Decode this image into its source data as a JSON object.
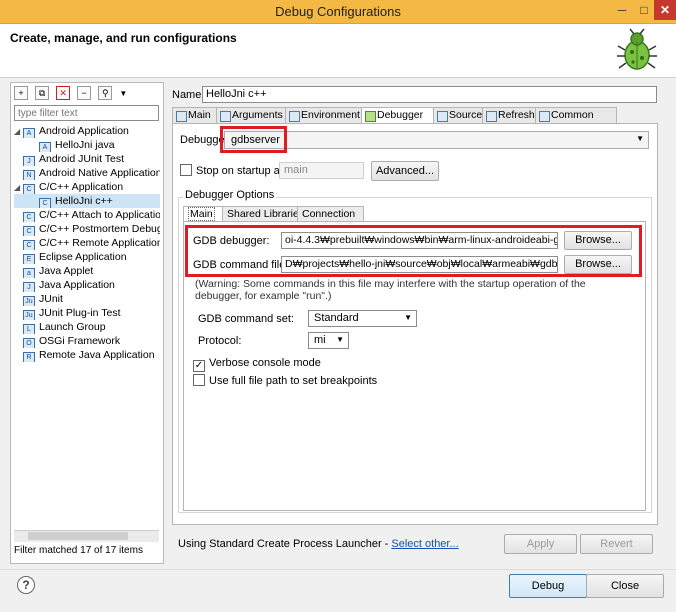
{
  "window": {
    "title": "Debug Configurations",
    "minimize": "─",
    "maximize": "□",
    "close": "✕"
  },
  "banner": {
    "heading": "Create, manage, and run configurations"
  },
  "left": {
    "filter_placeholder": "type filter text",
    "tree": [
      {
        "label": "Android Application",
        "level": 0,
        "toggle": "◢",
        "icon": "A"
      },
      {
        "label": "HelloJni java",
        "level": 1,
        "toggle": "",
        "icon": "A"
      },
      {
        "label": "Android JUnit Test",
        "level": 0,
        "toggle": "",
        "icon": "J"
      },
      {
        "label": "Android Native Application",
        "level": 0,
        "toggle": "",
        "icon": "N"
      },
      {
        "label": "C/C++ Application",
        "level": 0,
        "toggle": "◢",
        "icon": "C"
      },
      {
        "label": "HelloJni c++",
        "level": 1,
        "toggle": "",
        "icon": "C",
        "selected": true
      },
      {
        "label": "C/C++ Attach to Application",
        "level": 0,
        "toggle": "",
        "icon": "C"
      },
      {
        "label": "C/C++ Postmortem Debugger",
        "level": 0,
        "toggle": "",
        "icon": "C"
      },
      {
        "label": "C/C++ Remote Application",
        "level": 0,
        "toggle": "",
        "icon": "C"
      },
      {
        "label": "Eclipse Application",
        "level": 0,
        "toggle": "",
        "icon": "E"
      },
      {
        "label": "Java Applet",
        "level": 0,
        "toggle": "",
        "icon": "a"
      },
      {
        "label": "Java Application",
        "level": 0,
        "toggle": "",
        "icon": "J"
      },
      {
        "label": "JUnit",
        "level": 0,
        "toggle": "",
        "icon": "Ju"
      },
      {
        "label": "JUnit Plug-in Test",
        "level": 0,
        "toggle": "",
        "icon": "Ju"
      },
      {
        "label": "Launch Group",
        "level": 0,
        "toggle": "",
        "icon": "L"
      },
      {
        "label": "OSGi Framework",
        "level": 0,
        "toggle": "",
        "icon": "O"
      },
      {
        "label": "Remote Java Application",
        "level": 0,
        "toggle": "",
        "icon": "R"
      }
    ],
    "filter_status": "Filter matched 17 of 17 items"
  },
  "config": {
    "name_label": "Name:",
    "name_value": "HelloJni c++",
    "tabs": [
      "Main",
      "Arguments",
      "Environment",
      "Debugger",
      "Source",
      "Refresh",
      "Common"
    ],
    "active_tab": "Debugger",
    "debugger_label": "Debugger:",
    "debugger_value": "gdbserver",
    "stop_label": "Stop on startup at:",
    "stop_value": "main",
    "advanced_label": "Advanced...",
    "options_label": "Debugger Options",
    "inner_tabs": [
      "Main",
      "Shared Libraries",
      "Connection"
    ],
    "gdb_debugger_label": "GDB debugger:",
    "gdb_debugger_value": "oi-4.4.3₩prebuilt₩windows₩bin₩arm-linux-androideabi-gdb.exe",
    "gdb_cmdfile_label": "GDB command file:",
    "gdb_cmdfile_value": "D₩projects₩hello-jni₩source₩obj₩local₩armeabi₩gdbwin.setup",
    "browse_label": "Browse...",
    "warning": "(Warning: Some commands in this file may interfere with the startup operation of the debugger, for example \"run\".)",
    "cmdset_label": "GDB command set:",
    "cmdset_value": "Standard",
    "protocol_label": "Protocol:",
    "protocol_value": "mi",
    "verbose_label": "Verbose console mode",
    "verbose_checked": true,
    "fullpath_label": "Use full file path to set breakpoints",
    "fullpath_checked": false,
    "launcher_text": "Using Standard Create Process Launcher - ",
    "launcher_link": "Select other...",
    "apply_label": "Apply",
    "revert_label": "Revert"
  },
  "footer": {
    "help": "?",
    "debug_label": "Debug",
    "close_label": "Close"
  },
  "colors": {
    "titlebar": "#f3b944",
    "highlight": "#e01b24",
    "selection": "#cde4f7"
  }
}
